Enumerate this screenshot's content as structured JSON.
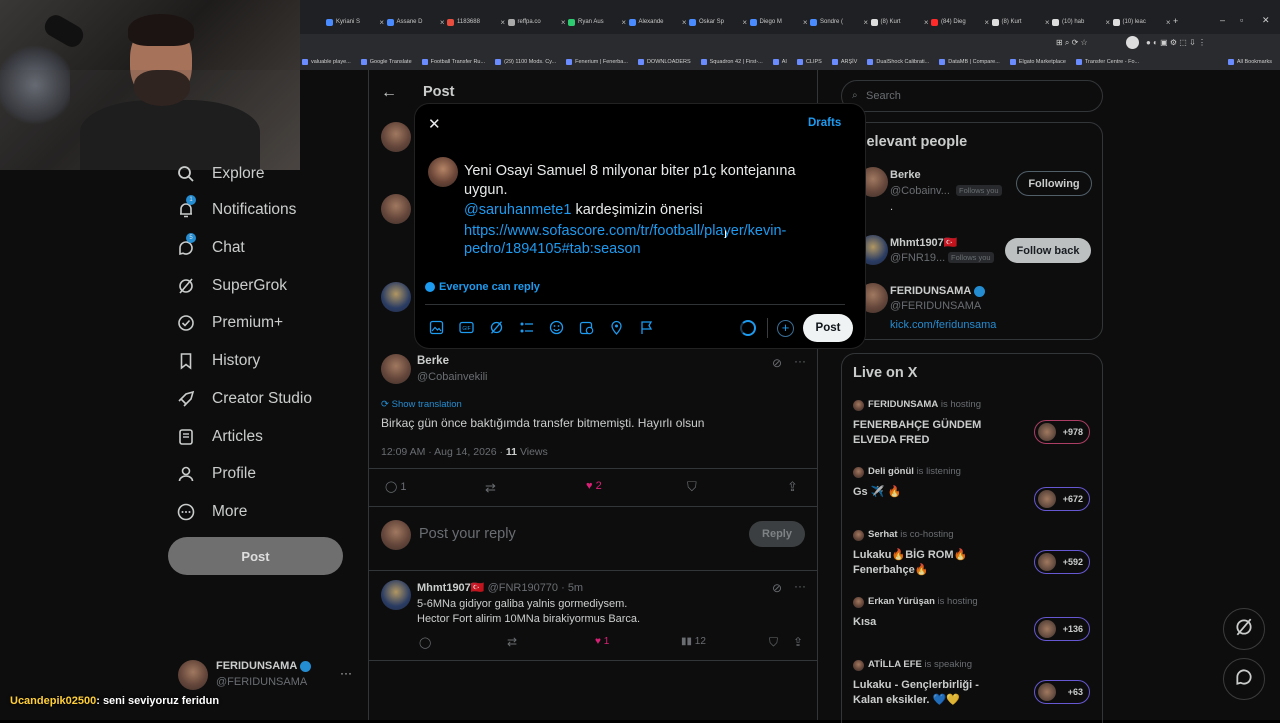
{
  "browser": {
    "tabs": [
      {
        "label": "Kyriani S",
        "color": "#4a8cff"
      },
      {
        "label": "Assane D",
        "color": "#4a8cff"
      },
      {
        "label": "1183688",
        "color": "#e84d3d"
      },
      {
        "label": "reffpa.co",
        "color": "#aaaaaa"
      },
      {
        "label": "Ryan Aus",
        "color": "#2ecc71"
      },
      {
        "label": "Alexande",
        "color": "#4a8cff"
      },
      {
        "label": "Oskar Sp",
        "color": "#4a8cff"
      },
      {
        "label": "Diego M",
        "color": "#4a8cff"
      },
      {
        "label": "Sondre (",
        "color": "#4a8cff"
      },
      {
        "label": "(8) Kurt",
        "color": "#dddddd"
      },
      {
        "label": "(84) Dieg",
        "color": "#ff2a2a"
      },
      {
        "label": "(8) Kurt",
        "color": "#dddddd"
      },
      {
        "label": "(10) hab",
        "color": "#dddddd"
      },
      {
        "label": "(10) leac",
        "color": "#dddddd"
      }
    ],
    "bookmarks": [
      "valuable playe...",
      "Google Translate",
      "Football Transfer Ru...",
      "(29) 1100 Mods. Cy...",
      "Fenerium | Fenerba...",
      "DOWNLOADERS",
      "Squadron 42 | First-...",
      "AI",
      "CLIPS",
      "ARŞİV",
      "DualShock Calibrati...",
      "DataMB | Compare...",
      "Elgato Marketplace",
      "Transfer Centre - Fo...",
      "All Bookmarks"
    ]
  },
  "nav": {
    "items": [
      {
        "label": "Explore",
        "icon": "search-icon"
      },
      {
        "label": "Notifications",
        "icon": "bell-icon",
        "badge": "1"
      },
      {
        "label": "Chat",
        "icon": "chat-icon",
        "badge": "5"
      },
      {
        "label": "SuperGrok",
        "icon": "grok-icon"
      },
      {
        "label": "Premium+",
        "icon": "premium-icon"
      },
      {
        "label": "History",
        "icon": "bookmark-icon"
      },
      {
        "label": "Creator Studio",
        "icon": "rocket-icon"
      },
      {
        "label": "Articles",
        "icon": "article-icon"
      },
      {
        "label": "Profile",
        "icon": "person-icon"
      },
      {
        "label": "More",
        "icon": "more-icon"
      }
    ],
    "post_label": "Post",
    "account": {
      "name": "FERIDUNSAMA",
      "handle": "@FERIDUNSAMA"
    }
  },
  "center": {
    "header_title": "Post",
    "reply_tweet": {
      "name": "Berke",
      "handle": "@Cobainvekili",
      "show_translation": "Show translation",
      "text": "Birkaç gün önce baktığımda transfer bitmemişti. Hayırlı olsun",
      "meta": "12:09 AM · Aug 14, 2026 · ",
      "views_count": "11",
      "views_label": " Views",
      "replies": "1",
      "likes": "2"
    },
    "reply_box": {
      "placeholder": "Post your reply",
      "button": "Reply"
    },
    "comment": {
      "name": "Mhmt1907🇹🇷",
      "handle": "@FNR190770 · 5m",
      "line1": "5-6MNa gidiyor galiba yalnis gormediysem.",
      "line2": "Hector Fort alirim 10MNa birakiyormus Barca.",
      "likes": "1",
      "views": "12"
    }
  },
  "modal": {
    "drafts": "Drafts",
    "text_line1": "Yeni Osayi Samuel 8 milyonar biter p1ç kontejanına",
    "text_line2": "uygun.",
    "mention": "@saruhanmete1",
    "text_line3": " kardeşimizin önerisi",
    "link_line1": "https://www.sofascore.com/tr/football/player/kevin-",
    "link_line2": "pedro/1894105#tab:season",
    "reply_setting": "Everyone can reply",
    "post_label": "Post"
  },
  "right": {
    "search_placeholder": "Search",
    "relevant_title": "Relevant people",
    "people": [
      {
        "name": "Berke",
        "handle": "@Cobainv...",
        "follows_you": "Follows you",
        "bio": ".",
        "button": "Following"
      },
      {
        "name": "Mhmt1907🇹🇷",
        "handle": "@FNR19...",
        "follows_you": "Follows you",
        "bio": "",
        "button": "Follow back"
      },
      {
        "name": "FERIDUNSAMA",
        "handle": "@FERIDUNSAMA",
        "bio": "kick.com/feridunsama",
        "button": ""
      }
    ],
    "live_title": "Live on X",
    "spaces": [
      {
        "host": "FERIDUNSAMA",
        "status": "is hosting",
        "title": "FENERBAHÇE GÜNDEM ELVEDA FRED",
        "count": "+978"
      },
      {
        "host": "Deli gönül",
        "status": "is listening",
        "title": "Gs ✈️ 🔥",
        "count": "+672"
      },
      {
        "host": "Serhat",
        "status": "is co-hosting",
        "title": "Lukaku🔥BİG ROM🔥 Fenerbahçe🔥",
        "count": "+592"
      },
      {
        "host": "Erkan Yürüşan",
        "status": "is hosting",
        "title": "Kısa",
        "count": "+136"
      },
      {
        "host": "ATİLLA EFE",
        "status": "is speaking",
        "title": "Lukaku - Gençlerbirliği - Kalan eksikler. 💙💛",
        "count": "+63"
      }
    ]
  },
  "stream_chat": {
    "user": "Ucandepik02500",
    "message": ": seni seviyoruz feridun"
  }
}
